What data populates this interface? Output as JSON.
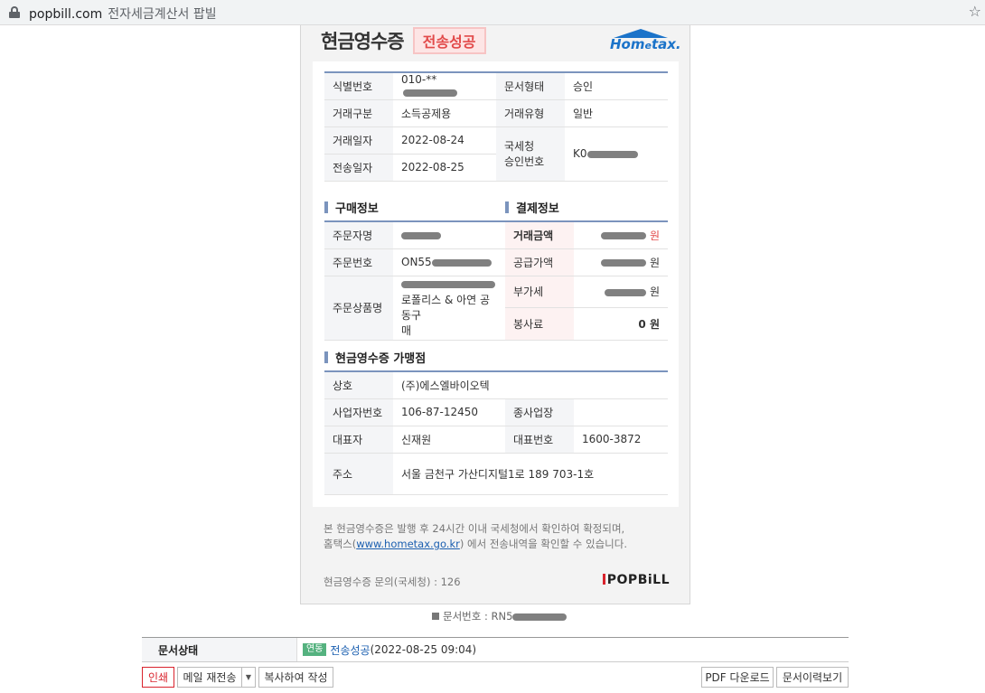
{
  "browser": {
    "domain": "popbill.com",
    "page_title": "전자세금계산서 팝빌"
  },
  "receipt": {
    "title": "현금영수증",
    "status_badge": "전송성공",
    "logo_text": "Hometax.",
    "basic": {
      "id_label": "식별번호",
      "id_value": "010-**",
      "doc_type_label": "문서형태",
      "doc_type_value": "승인",
      "trade_class_label": "거래구분",
      "trade_class_value": "소득공제용",
      "trade_type_label": "거래유형",
      "trade_type_value": "일반",
      "trade_date_label": "거래일자",
      "trade_date_value": "2022-08-24",
      "nts_label_1": "국세청",
      "nts_label_2": "승인번호",
      "nts_value": "K0",
      "send_date_label": "전송일자",
      "send_date_value": "2022-08-25"
    },
    "purchase": {
      "section_title": "구매정보",
      "orderer_label": "주문자명",
      "order_no_label": "주문번호",
      "order_no_value": "ON55",
      "product_label": "주문상품명",
      "product_value_line2": "로폴리스 & 아연 공동구",
      "product_value_line3": "매"
    },
    "payment": {
      "section_title": "결제정보",
      "amount_label": "거래금액",
      "amount_unit": "원",
      "supply_label": "공급가액",
      "supply_unit": "원",
      "vat_label": "부가세",
      "vat_unit": "원",
      "service_label": "봉사료",
      "service_value": "0 원"
    },
    "merchant": {
      "section_title": "현금영수증 가맹점",
      "name_label": "상호",
      "name_value": "(주)에스엘바이오텍",
      "bizno_label": "사업자번호",
      "bizno_value": "106-87-12450",
      "category_label": "종사업장",
      "ceo_label": "대표자",
      "ceo_value": "신재원",
      "phone_label": "대표번호",
      "phone_value": "1600-3872",
      "address_label": "주소",
      "address_value": "서울 금천구 가산디지털1로 189 703-1호"
    },
    "note_line1": "본 현금영수증은 발행 후 24시간 이내 국세청에서 확인하여 확정되며,",
    "note_prefix": "홈택스(",
    "note_link": "www.hometax.go.kr",
    "note_suffix": ") 에서 전송내역을 확인할 수 있습니다.",
    "inquiry": "현금영수증 문의(국세청) : 126",
    "brand": "POPBiLL"
  },
  "doc_number": "문서번호 : RN5",
  "status": {
    "label": "문서상태",
    "tag": "연동",
    "value": "전송성공",
    "time": "(2022-08-25 09:04)"
  },
  "buttons": {
    "print": "인쇄",
    "resend_mail": "메일 재전송",
    "copy_create": "복사하여 작성",
    "pdf_download": "PDF 다운로드",
    "history": "문서이력보기"
  }
}
